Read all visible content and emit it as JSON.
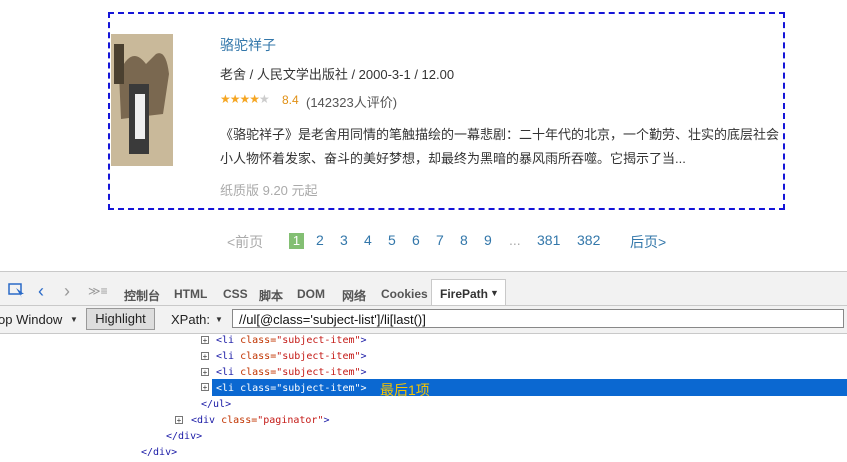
{
  "book": {
    "title": "骆驼祥子",
    "pub": "老舍 / 人民文学出版社 / 2000-3-1 / 12.00",
    "score": "8.4",
    "rating_count": "(142323人评价)",
    "stars_value": 4.0,
    "description": "《骆驼祥子》是老舍用同情的笔触描绘的一幕悲剧：二十年代的北京，一个勤劳、壮实的底层社会小人物怀着发家、奋斗的美好梦想，却最终为黑暗的暴风雨所吞噬。它揭示了当...",
    "price": "纸质版 9.20 元起",
    "cover_text": "骆驼祥子"
  },
  "paginator": {
    "prev": "<前页",
    "current": "1",
    "pages": [
      "2",
      "3",
      "4",
      "5",
      "6",
      "7",
      "8",
      "9"
    ],
    "ellipsis": "...",
    "p381": "381",
    "p382": "382",
    "next": "后页>"
  },
  "devtools": {
    "tabs": [
      "控制台",
      "HTML",
      "CSS",
      "脚本",
      "DOM",
      "网络",
      "Cookies"
    ],
    "firepath": "FirePath",
    "drop_window": "op Window",
    "highlight": "Highlight",
    "xpath_label": "XPath:",
    "xpath_value": "//ul[@class='subject-list']/li[last()]",
    "li_rows": [
      "subject-item",
      "subject-item",
      "subject-item",
      "subject-item"
    ],
    "close_ul": "</ul>",
    "div_tag": "<div",
    "div_attr": "class=",
    "div_val": "\"paginator\"",
    "close_div1": "</div>",
    "close_div2": "</div>",
    "note": "最后1项"
  }
}
